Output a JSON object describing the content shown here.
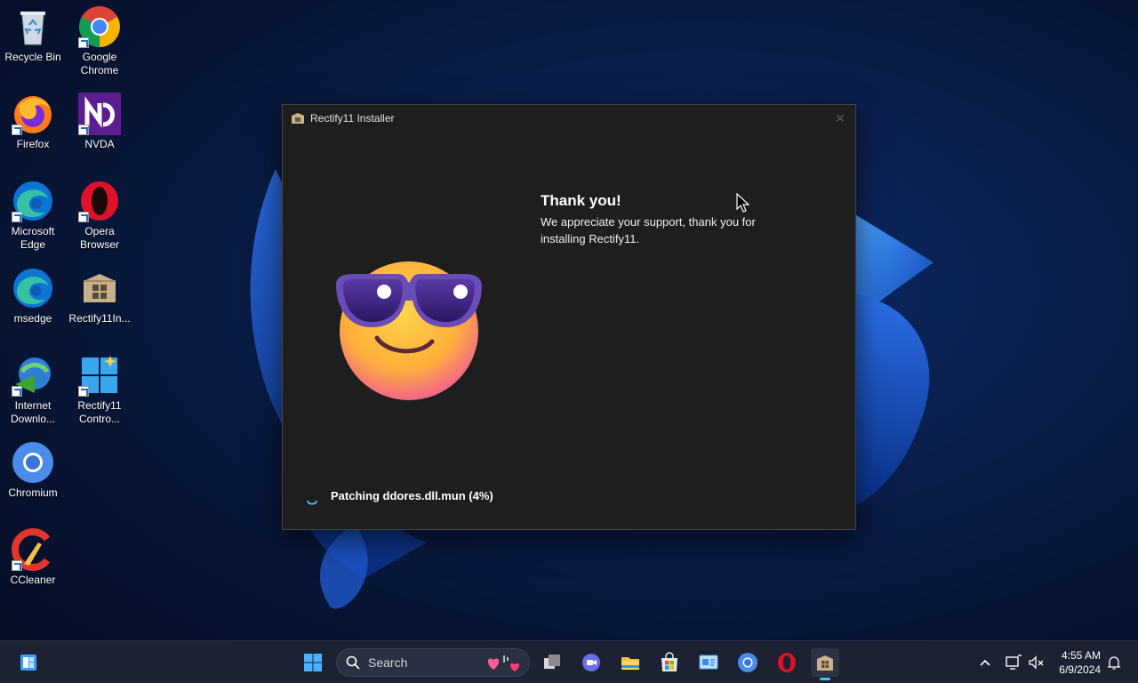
{
  "desktop": {
    "icons": [
      {
        "label": "Recycle Bin",
        "icon": "recycle-bin-icon",
        "shortcut": false
      },
      {
        "label": "Google Chrome",
        "icon": "google-chrome-icon",
        "shortcut": true
      },
      {
        "label": "Firefox",
        "icon": "firefox-icon",
        "shortcut": true
      },
      {
        "label": "NVDA",
        "icon": "nvda-icon",
        "shortcut": true
      },
      {
        "label": "Microsoft Edge",
        "icon": "microsoft-edge-icon",
        "shortcut": true
      },
      {
        "label": "Opera Browser",
        "icon": "opera-icon",
        "shortcut": true
      },
      {
        "label": "msedge",
        "icon": "msedge-icon",
        "shortcut": false
      },
      {
        "label": "Rectify11In...",
        "icon": "rectify11-installer-icon",
        "shortcut": false
      },
      {
        "label": "Internet Downlo...",
        "icon": "internet-download-manager-icon",
        "shortcut": true
      },
      {
        "label": "Rectify11 Contro...",
        "icon": "rectify11-control-center-icon",
        "shortcut": true
      },
      {
        "label": "Chromium",
        "icon": "chromium-icon",
        "shortcut": false
      },
      {
        "label": "CCleaner",
        "icon": "ccleaner-icon",
        "shortcut": true
      }
    ]
  },
  "installer": {
    "title": "Rectify11 Installer",
    "heading": "Thank you!",
    "message": "We appreciate your support, thank you for installing Rectify11.",
    "status": "Patching ddores.dll.mun (4%)",
    "progress_percent": 4,
    "illustration": "smiling-face-with-sunglasses-emoji"
  },
  "taskbar": {
    "search_label": "Search",
    "pinned": [
      "widgets",
      "start",
      "search",
      "task-view",
      "teams-chat",
      "file-explorer",
      "microsoft-store",
      "control-panel",
      "chromium",
      "opera",
      "rectify11-installer"
    ],
    "active": "rectify11-installer",
    "clock": {
      "time": "4:55 AM",
      "date": "6/9/2024"
    }
  },
  "colors": {
    "accent": "#4cc2ff",
    "window_bg": "#1e1e1e",
    "taskbar_bg": "#1c2232"
  }
}
